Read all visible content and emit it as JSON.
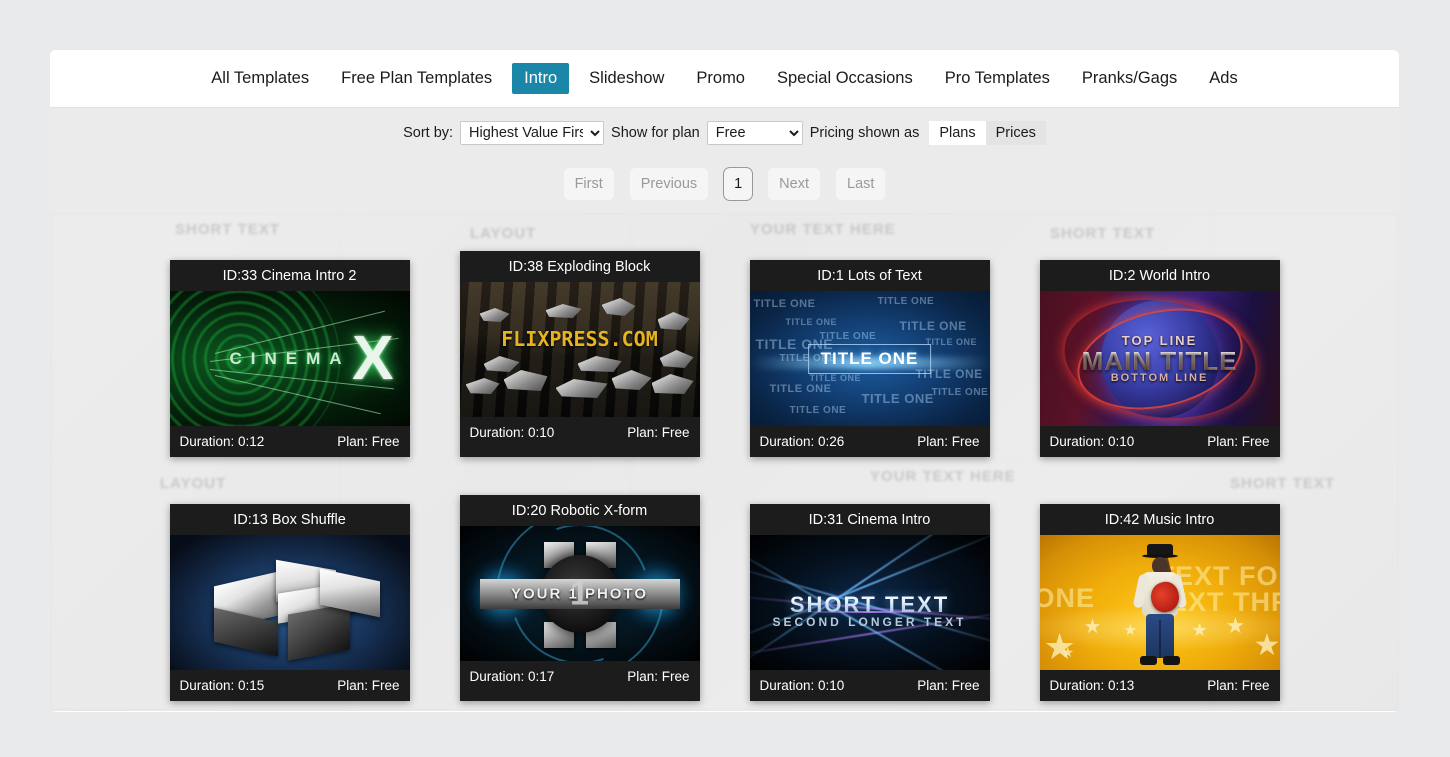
{
  "nav": {
    "items": [
      {
        "label": "All Templates",
        "active": false
      },
      {
        "label": "Free Plan Templates",
        "active": false
      },
      {
        "label": "Intro",
        "active": true
      },
      {
        "label": "Slideshow",
        "active": false
      },
      {
        "label": "Promo",
        "active": false
      },
      {
        "label": "Special Occasions",
        "active": false
      },
      {
        "label": "Pro Templates",
        "active": false
      },
      {
        "label": "Pranks/Gags",
        "active": false
      },
      {
        "label": "Ads",
        "active": false
      }
    ],
    "active_color": "#1b87a8"
  },
  "controls": {
    "sort_label": "Sort by:",
    "sort_value": "Highest Value First",
    "sort_options": [
      "Highest Value First"
    ],
    "plan_label": "Show for plan",
    "plan_value": "Free",
    "plan_options": [
      "Free"
    ],
    "pricing_label": "Pricing shown as",
    "pricing_plans": "Plans",
    "pricing_prices": "Prices",
    "pricing_selected": "Plans"
  },
  "pagination": {
    "first": "First",
    "previous": "Previous",
    "current": "1",
    "next": "Next",
    "last": "Last"
  },
  "cards": [
    {
      "title": "ID:33 Cinema Intro 2",
      "duration": "Duration: 0:12",
      "plan": "Plan: Free"
    },
    {
      "title": "ID:38 Exploding Block",
      "duration": "Duration: 0:10",
      "plan": "Plan: Free"
    },
    {
      "title": "ID:1 Lots of Text",
      "duration": "Duration: 0:26",
      "plan": "Plan: Free"
    },
    {
      "title": "ID:2 World Intro",
      "duration": "Duration: 0:10",
      "plan": "Plan: Free"
    },
    {
      "title": "ID:13 Box Shuffle",
      "duration": "Duration: 0:15",
      "plan": "Plan: Free"
    },
    {
      "title": "ID:20 Robotic X-form",
      "duration": "Duration: 0:17",
      "plan": "Plan: Free"
    },
    {
      "title": "ID:31 Cinema Intro",
      "duration": "Duration: 0:10",
      "plan": "Plan: Free"
    },
    {
      "title": "ID:42 Music Intro",
      "duration": "Duration: 0:13",
      "plan": "Plan: Free"
    }
  ],
  "thumb_text": {
    "t1_letters": "CINEMA",
    "t1_x": "X",
    "t2_logo": "FLIXPRESS.COM",
    "t3_main": "TITLE ONE",
    "t3_scatter": "TITLE ONE",
    "t4_top": "TOP LINE",
    "t4_main": "MAIN TITLE",
    "t4_bottom": "BOTTOM LINE",
    "t6_bar": "YOUR 1 PHOTO",
    "t6_num": "1",
    "t7_short": "SHORT TEXT",
    "t7_second": "SECOND LONGER TEXT",
    "t8_one": "ONE",
    "t8_four": "TEXT FOUR",
    "t8_three": "TEXT THREE"
  },
  "watermarks": [
    "SHORT TEXT",
    "LAYOUT",
    "YOUR TEXT HERE",
    "SHORT TEXT",
    "LAYOUT",
    "YOUR TEXT HERE",
    "SHORT TEXT"
  ]
}
